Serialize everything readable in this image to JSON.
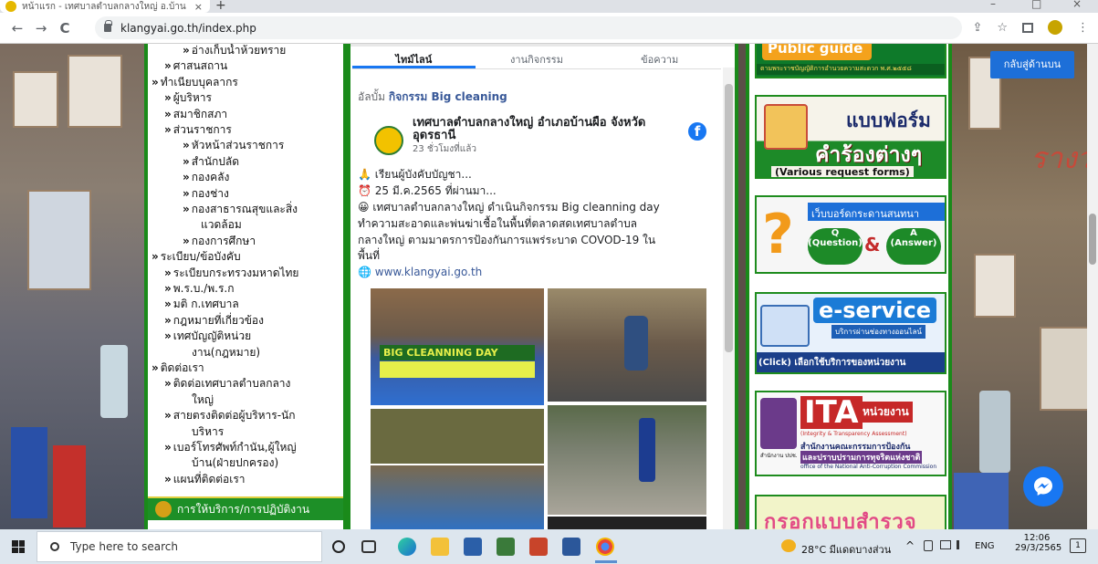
{
  "browser": {
    "tab_title": "หน้าแรก - เทศบาลตำบลกลางใหญ่ อ.บ้านผือ จ.ฯ",
    "tab_close": "×",
    "new_tab": "+",
    "win_min": "–",
    "win_max": "□",
    "win_close": "×",
    "back": "←",
    "forward": "→",
    "reload": "C",
    "url": "klangyai.go.th/index.php",
    "share": "⇪",
    "star": "☆",
    "menu": "⋮"
  },
  "sidebar": {
    "items": [
      {
        "text": "อ่างเก็บน้ำห้วยทราย",
        "level": 2
      },
      {
        "text": "ศาสนสถาน",
        "level": 1
      },
      {
        "text": "ทำเนียบบุคลากร",
        "level": 0
      },
      {
        "text": "ผู้บริหาร",
        "level": 1
      },
      {
        "text": "สมาชิกสภา",
        "level": 1
      },
      {
        "text": "ส่วนราชการ",
        "level": 1
      },
      {
        "text": "หัวหน้าส่วนราชการ",
        "level": 2
      },
      {
        "text": "สำนักปลัด",
        "level": 2
      },
      {
        "text": "กองคลัง",
        "level": 2
      },
      {
        "text": "กองช่าง",
        "level": 2
      },
      {
        "text": "กองสาธารณสุขและสิ่ง",
        "level": 2
      },
      {
        "text": "แวดล้อม",
        "level": 3
      },
      {
        "text": "กองการศึกษา",
        "level": 2
      },
      {
        "text": "ระเบียบ/ข้อบังคับ",
        "level": 0
      },
      {
        "text": "ระเบียบกระทรวงมหาดไทย",
        "level": 1
      },
      {
        "text": "พ.ร.บ./พ.ร.ก",
        "level": 1
      },
      {
        "text": "มติ ก.เทศบาล",
        "level": 1
      },
      {
        "text": "กฎหมายที่เกี่ยวข้อง",
        "level": 1
      },
      {
        "text": "เทศบัญญัติหน่วย",
        "level": 1
      },
      {
        "text": "งาน(กฎหมาย)",
        "level": 4
      },
      {
        "text": "ติดต่อเรา",
        "level": 0
      },
      {
        "text": "ติดต่อเทศบาลตำบลกลาง",
        "level": 1
      },
      {
        "text": "ใหญ่",
        "level": 4
      },
      {
        "text": "สายตรงติดต่อผู้บริหาร-นัก",
        "level": 1
      },
      {
        "text": "บริหาร",
        "level": 4
      },
      {
        "text": "เบอร์โทรศัพท์กำนัน,ผู้ใหญ่",
        "level": 1
      },
      {
        "text": "บ้าน(ฝ่ายปกครอง)",
        "level": 4
      },
      {
        "text": "แผนที่ติดต่อเรา",
        "level": 1
      }
    ],
    "service_bar": "การให้บริการ/การปฏิบัติงาน"
  },
  "feed": {
    "tabs": [
      "ไทม์ไลน์",
      "งานกิจกรรม",
      "ข้อความ"
    ],
    "album_prefix": "อัลบั้ม",
    "album_name": "กิจกรรม Big cleaning",
    "page_name_1": "เทศบาลตำบลกลางใหญ่ อำเภอบ้านผือ จังหวัด",
    "page_name_2": "อุดรธานี",
    "time": "23 ชั่วโมงที่แล้ว",
    "line1": "🙏 เรียนผู้บังคับบัญชา...",
    "line2": "⏰ 25 มี.ค.2565 ที่ผ่านมา...",
    "line3": "😀 เทศบาลตำบลกลางใหญ่ ดำเนินกิจกรรม Big cleanning day",
    "line4": "ทำความสะอาดและพ่นฆ่าเชื้อในพื้นที่ตลาดสดเทศบาลตำบล",
    "line5": "กลางใหญ่ ตามมาตรการป้องกันการแพร่ระบาด COVOD-19 ใน",
    "line6": "พื้นที่",
    "link": "🌐 www.klangyai.go.th",
    "photo_banner": "BIG CLEANNING DAY",
    "fb_letter": "f"
  },
  "right": {
    "public_guide": "Public guide",
    "public_guide_sub": "ตามพระราชบัญญัติการอำนวยความสะดวก พ.ศ.๒๕๕๘",
    "forms_title": "แบบฟอร์ม",
    "forms_title2": "คำร้องต่างๆ",
    "forms_sub": "(Various request forms)",
    "webboard": "เว็บบอร์ดกระดานสนทนา",
    "q": "Q",
    "q_sub": "(Question)",
    "amp": "&",
    "a": "A",
    "a_sub": "(Answer)",
    "eservice": "e-service",
    "eservice_sub": "(Click) เลือกใช้บริการของหน่วยงาน",
    "eservice_band": "บริการผ่านช่องทางออนไลน์",
    "ita": "ITA",
    "ita_unit": "หน่วยงาน",
    "ita_sub": "(Integrity & Transparency Assessment)",
    "ita_org1": "สำนักงานคณะกรรมการป้องกัน",
    "ita_org2": "และปราบปรามการทุจริตแห่งชาติ",
    "ita_org3": "office of the National Anti-Corruption Commission",
    "ita_label": "สำนักงาน ปปช.",
    "survey": "กรอกแบบสำรวจ",
    "back_top": "กลับสู่ด้านบน",
    "bg_text": "รางวัลที่"
  },
  "taskbar": {
    "search_placeholder": "Type here to search",
    "weather": "28°C มีแดดบางส่วน",
    "caret": "^",
    "lang": "ENG",
    "time": "12:06",
    "date": "29/3/2565",
    "notif": "1"
  }
}
